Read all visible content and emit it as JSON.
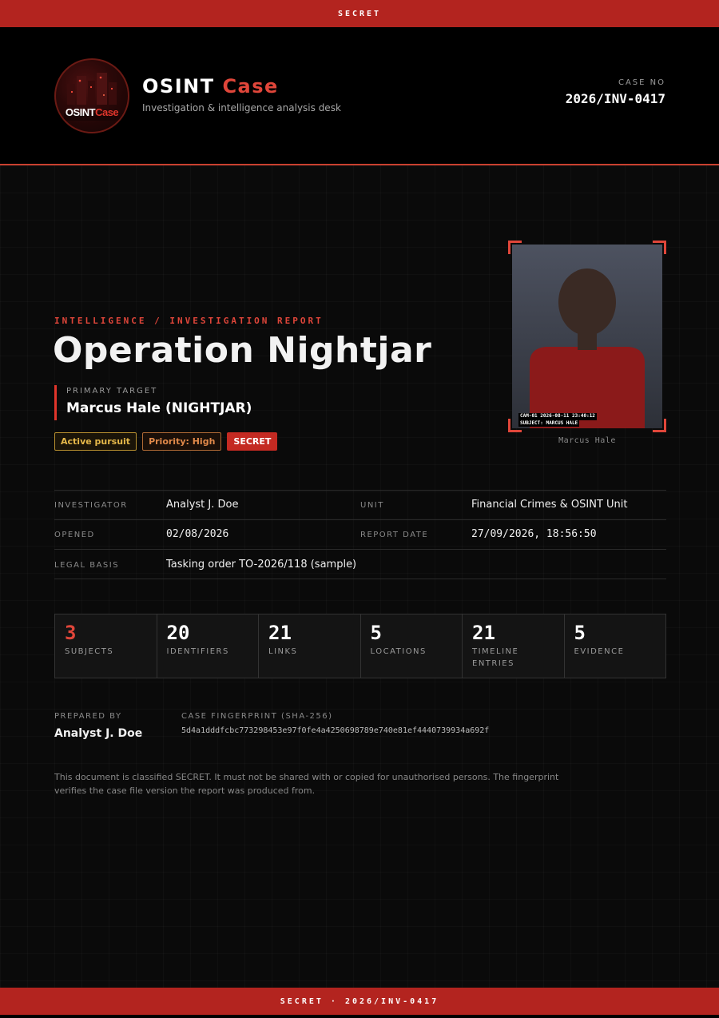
{
  "classification_banner": "SECRET",
  "footer_banner": "SECRET · 2026/INV-0417",
  "brand": {
    "title_part1": "OSINT",
    "title_part2": "Case",
    "subtitle": "Investigation & intelligence analysis desk",
    "logo_text_part1": "OSINT",
    "logo_text_part2": "Case"
  },
  "case": {
    "label": "CASE NO",
    "number": "2026/INV-0417"
  },
  "report": {
    "kicker": "INTELLIGENCE / INVESTIGATION REPORT",
    "title": "Operation Nightjar",
    "target_label": "PRIMARY TARGET",
    "target_name": "Marcus Hale (NIGHTJAR)",
    "badges": [
      "Active pursuit",
      "Priority: High",
      "SECRET"
    ]
  },
  "photo": {
    "cam_line1": "CAM-01  2026-08-11  23:40:12",
    "cam_line2": "SUBJECT: MARCUS HALE",
    "caption": "Marcus Hale"
  },
  "meta": {
    "investigator_label": "INVESTIGATOR",
    "investigator": "Analyst J. Doe",
    "unit_label": "UNIT",
    "unit": "Financial Crimes & OSINT Unit",
    "opened_label": "OPENED",
    "opened": "02/08/2026",
    "report_date_label": "REPORT DATE",
    "report_date": "27/09/2026, 18:56:50",
    "legal_basis_label": "LEGAL BASIS",
    "legal_basis": "Tasking order TO-2026/118 (sample)"
  },
  "stats": [
    {
      "value": "3",
      "label": "SUBJECTS"
    },
    {
      "value": "20",
      "label": "IDENTIFIERS"
    },
    {
      "value": "21",
      "label": "LINKS"
    },
    {
      "value": "5",
      "label": "LOCATIONS"
    },
    {
      "value": "21",
      "label": "TIMELINE ENTRIES"
    },
    {
      "value": "5",
      "label": "EVIDENCE"
    }
  ],
  "prepared": {
    "label": "PREPARED BY",
    "name": "Analyst J. Doe"
  },
  "fingerprint": {
    "label": "CASE FINGERPRINT (SHA-256)",
    "value": "5d4a1dddfcbc773298453e97f0fe4a4250698789e740e81ef4440739934a692f"
  },
  "notice": "This document is classified SECRET. It must not be shared with or copied for unauthorised persons. The fingerprint verifies the case file version the report was produced from.",
  "colors": {
    "accent": "#e0463a",
    "banner": "#b3241f"
  }
}
